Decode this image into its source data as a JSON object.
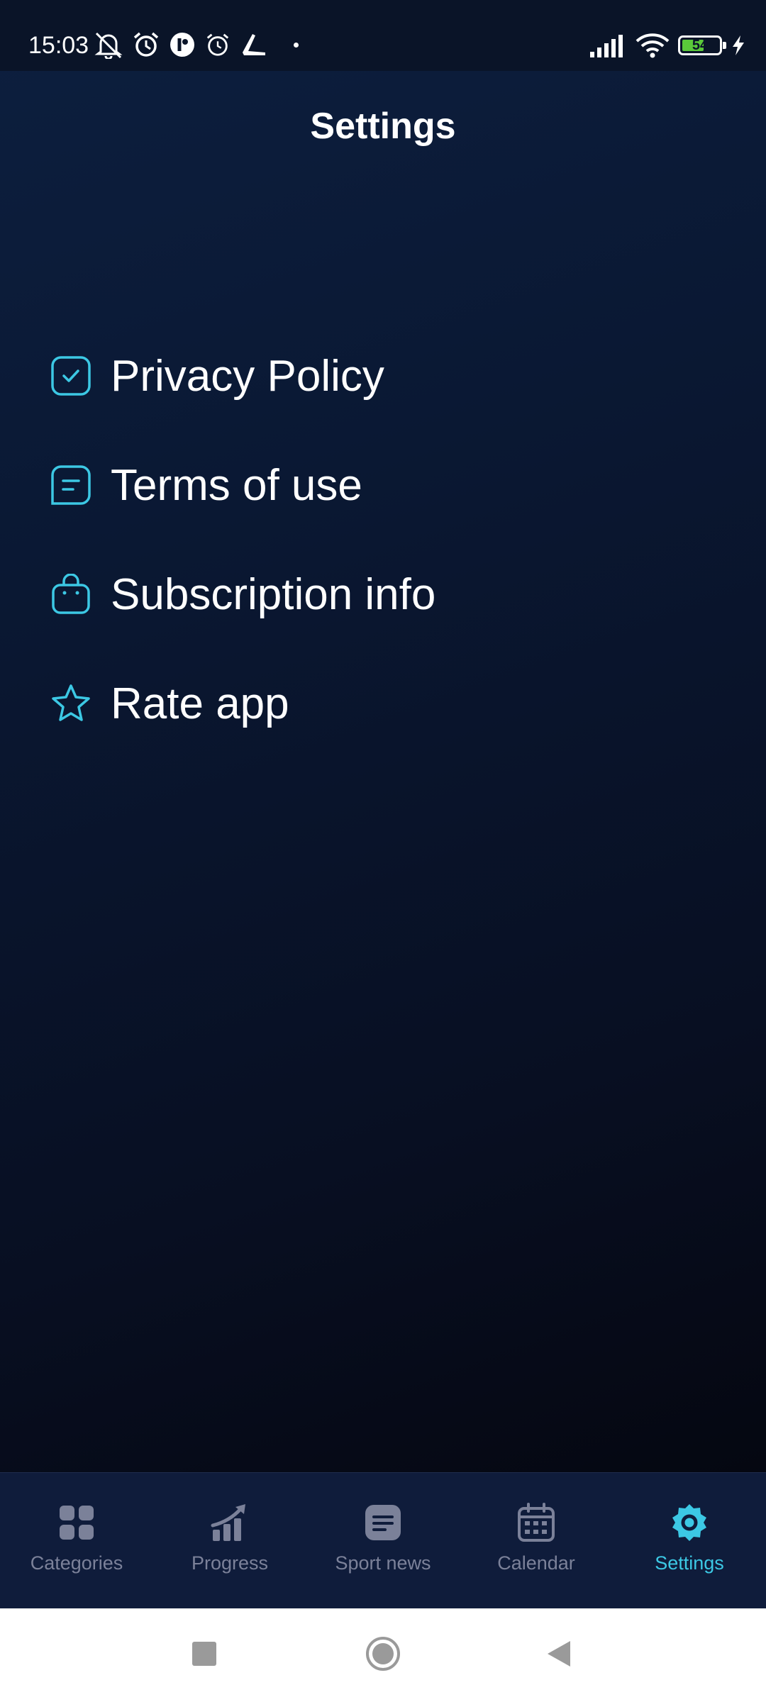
{
  "status_bar": {
    "time": "15:03",
    "battery_level": "54",
    "icons_left": [
      "mute-icon",
      "alarm-icon",
      "app-icon",
      "alarm-icon",
      "nike-icon",
      "dot-icon"
    ],
    "icons_right": [
      "signal-icon",
      "wifi-icon",
      "battery-icon",
      "charging-icon"
    ]
  },
  "header": {
    "title": "Settings"
  },
  "menu": {
    "items": [
      {
        "label": "Privacy Policy",
        "icon": "checkbox-icon"
      },
      {
        "label": "Terms of use",
        "icon": "note-icon"
      },
      {
        "label": "Subscription info",
        "icon": "shopping-bag-icon"
      },
      {
        "label": "Rate app",
        "icon": "star-icon"
      }
    ]
  },
  "bottom_nav": {
    "items": [
      {
        "label": "Categories",
        "icon": "grid-icon",
        "active": false
      },
      {
        "label": "Progress",
        "icon": "chart-up-icon",
        "active": false
      },
      {
        "label": "Sport news",
        "icon": "news-icon",
        "active": false
      },
      {
        "label": "Calendar",
        "icon": "calendar-icon",
        "active": false
      },
      {
        "label": "Settings",
        "icon": "gear-icon",
        "active": true
      }
    ]
  },
  "colors": {
    "accent": "#3cc8e4",
    "inactive": "#7b8199",
    "nav_background": "#0f1c3b"
  }
}
